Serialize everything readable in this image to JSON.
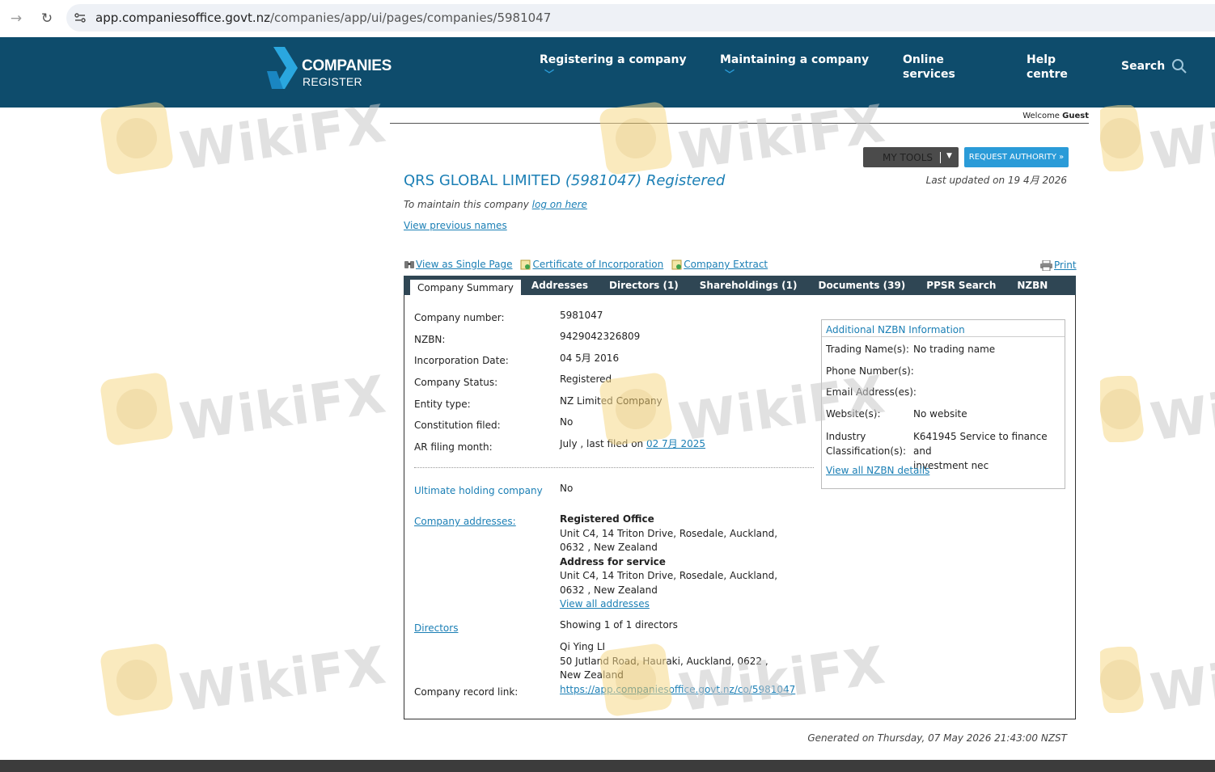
{
  "browser": {
    "url_host": "app.companiesoffice.govt.nz",
    "url_path": "/companies/app/ui/pages/companies/5981047"
  },
  "header": {
    "logo_line1": "COMPANIES",
    "logo_line2": "REGISTER",
    "menu": [
      {
        "label": "Registering a company"
      },
      {
        "label": "Maintaining a company"
      },
      {
        "label_line1": "Online",
        "label_line2": "services"
      },
      {
        "label_line1": "Help",
        "label_line2": "centre"
      }
    ],
    "search_label": "Search"
  },
  "welcome": {
    "prefix": "Welcome",
    "user": "Guest"
  },
  "tools": {
    "my_tools": "MY TOOLS",
    "request_authority": "REQUEST AUTHORITY »"
  },
  "company": {
    "name": "QRS GLOBAL LIMITED",
    "number_paren": "(5981047)",
    "status_title": "Registered",
    "last_updated": "Last updated on 19 4月 2026",
    "maintain_prefix": "To maintain this company",
    "maintain_link": "log on here",
    "view_previous_names": "View previous names"
  },
  "doc_links": {
    "single_page": "View as Single Page",
    "certificate": "Certificate of Incorporation",
    "extract": "Company Extract",
    "print": "Print"
  },
  "tabs": [
    "Company Summary",
    "Addresses",
    "Directors (1)",
    "Shareholdings (1)",
    "Documents (39)",
    "PPSR Search",
    "NZBN"
  ],
  "summary": {
    "rows": [
      {
        "label": "Company number:",
        "value": "5981047"
      },
      {
        "label": "NZBN:",
        "value": "9429042326809"
      },
      {
        "label": "Incorporation Date:",
        "value": "04 5月 2016"
      },
      {
        "label": "Company Status:",
        "value": "Registered"
      },
      {
        "label": "Entity type:",
        "value": "NZ Limited Company"
      },
      {
        "label": "Constitution filed:",
        "value": "No"
      }
    ],
    "ar_label": "AR filing month:",
    "ar_value_prefix": "July , last filed on",
    "ar_value_link": "02 7月 2025",
    "ultimate_label": "Ultimate holding company",
    "ultimate_value": "No",
    "addresses_label": "Company addresses:",
    "registered_office_title": "Registered Office",
    "registered_office_l1": "Unit C4, 14 Triton Drive, Rosedale, Auckland,",
    "registered_office_l2": "0632 , New Zealand",
    "service_title": "Address for service",
    "service_l1": "Unit C4, 14 Triton Drive, Rosedale, Auckland,",
    "service_l2": "0632 , New Zealand",
    "view_all_addresses": "View all addresses",
    "directors_label": "Directors",
    "directors_showing": "Showing 1 of 1 directors",
    "director_name": "Qi Ying LI",
    "director_addr_l1": "50 Jutland Road, Hauraki, Auckland, 0622 ,",
    "director_addr_l2": "New Zealand",
    "record_label": "Company record link:",
    "record_link": "https://app.companiesoffice.govt.nz/co/5981047"
  },
  "nzbn_info": {
    "title": "Additional NZBN Information",
    "trading_label": "Trading Name(s):",
    "trading_value": "No trading name",
    "phone_label": "Phone Number(s):",
    "email_label": "Email Address(es):",
    "website_label": "Website(s):",
    "website_value": "No website",
    "industry_label_l1": "Industry",
    "industry_label_l2": "Classification(s):",
    "industry_value_l1": "K641945 Service to finance and",
    "industry_value_l2": "investment nec",
    "view_all": "View all NZBN details"
  },
  "generated": "Generated on Thursday, 07 May 2026 21:43:00 NZST",
  "watermark_text": "WikiFX",
  "colors": {
    "header_bg": "#0e4c6c",
    "link": "#1b7fb5",
    "tab_bg": "#2f4654",
    "accent_button": "#2a9bd8"
  }
}
